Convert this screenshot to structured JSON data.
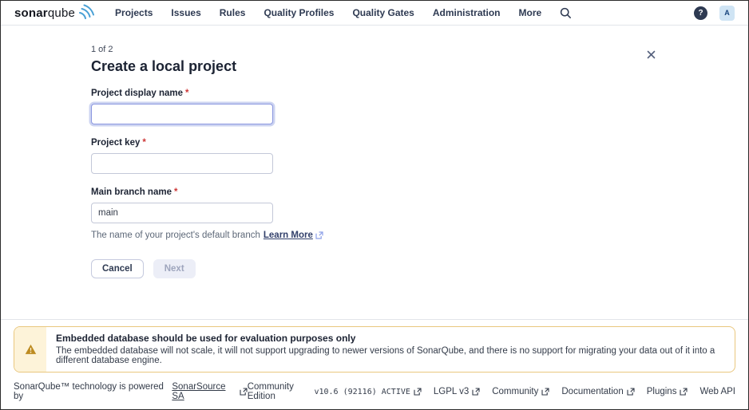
{
  "brand": {
    "name_bold": "sonar",
    "name_light": "qube"
  },
  "nav": {
    "items": [
      {
        "label": "Projects"
      },
      {
        "label": "Issues"
      },
      {
        "label": "Rules"
      },
      {
        "label": "Quality Profiles"
      },
      {
        "label": "Quality Gates"
      },
      {
        "label": "Administration"
      },
      {
        "label": "More"
      }
    ]
  },
  "header_actions": {
    "help_label": "?",
    "avatar_label": "A"
  },
  "wizard": {
    "step": "1 of 2",
    "title": "Create a local project"
  },
  "form": {
    "fields": [
      {
        "label": "Project display name",
        "required": "*",
        "value": ""
      },
      {
        "label": "Project key",
        "required": "*",
        "value": ""
      },
      {
        "label": "Main branch name",
        "required": "*",
        "value": "main"
      }
    ],
    "helper": {
      "text": "The name of your project's default branch",
      "link": "Learn More"
    },
    "buttons": {
      "cancel": "Cancel",
      "next": "Next"
    }
  },
  "banner": {
    "title": "Embedded database should be used for evaluation purposes only",
    "message": "The embedded database will not scale, it will not support upgrading to newer versions of SonarQube, and there is no support for migrating your data out of it into a different database engine."
  },
  "footer": {
    "powered_prefix": "SonarQube™ technology is powered by",
    "powered_link": "SonarSource SA",
    "edition": "Community Edition",
    "version": "v10.6 (92116) ACTIVE",
    "links": [
      {
        "label": "LGPL v3"
      },
      {
        "label": "Community"
      },
      {
        "label": "Documentation"
      },
      {
        "label": "Plugins"
      },
      {
        "label": "Web API"
      }
    ]
  },
  "colors": {
    "accent_blue": "#4aa0d5",
    "focus_ring": "#cdd4f1",
    "warning_border": "#e9c77e",
    "warning_bg": "#fdf3d9",
    "warning_icon": "#bd8b21",
    "required_red": "#cd3737"
  }
}
